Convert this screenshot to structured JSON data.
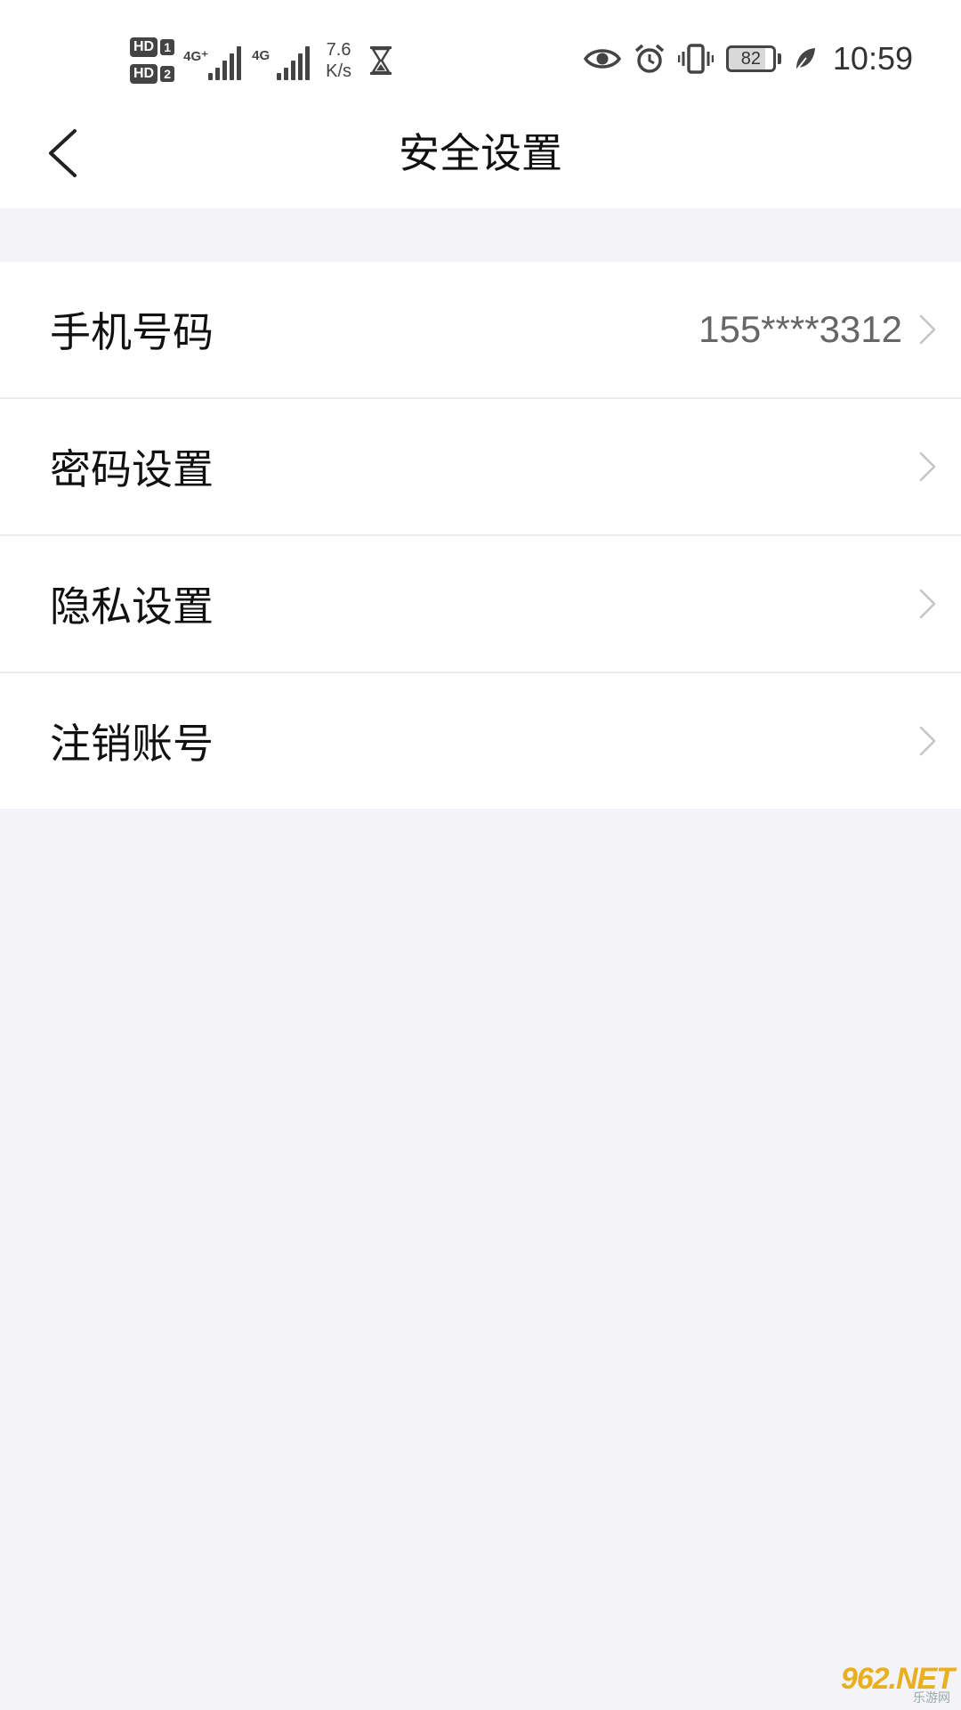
{
  "status_bar": {
    "sim1_badge": "HD",
    "sim1_num": "1",
    "sim2_badge": "HD",
    "sim2_num": "2",
    "net1": "4G⁺",
    "net2": "4G",
    "speed_value": "7.6",
    "speed_unit": "K/s",
    "battery_level": "82",
    "time": "10:59",
    "icons": [
      "hourglass-icon",
      "eye-icon",
      "alarm-icon",
      "vibrate-icon",
      "battery-icon",
      "leaf-icon"
    ]
  },
  "nav": {
    "title": "安全设置",
    "back_icon": "chevron-left-icon"
  },
  "settings": {
    "items": [
      {
        "label": "手机号码",
        "value": "155****3312"
      },
      {
        "label": "密码设置",
        "value": ""
      },
      {
        "label": "隐私设置",
        "value": ""
      },
      {
        "label": "注销账号",
        "value": ""
      }
    ]
  },
  "watermark": {
    "logo": "962.NET",
    "sub": "乐游网"
  },
  "colors": {
    "background": "#f3f3f8",
    "surface": "#ffffff",
    "text_primary": "#111111",
    "text_secondary": "#666666",
    "divider": "#ececec",
    "chevron": "#c4c4c4"
  }
}
